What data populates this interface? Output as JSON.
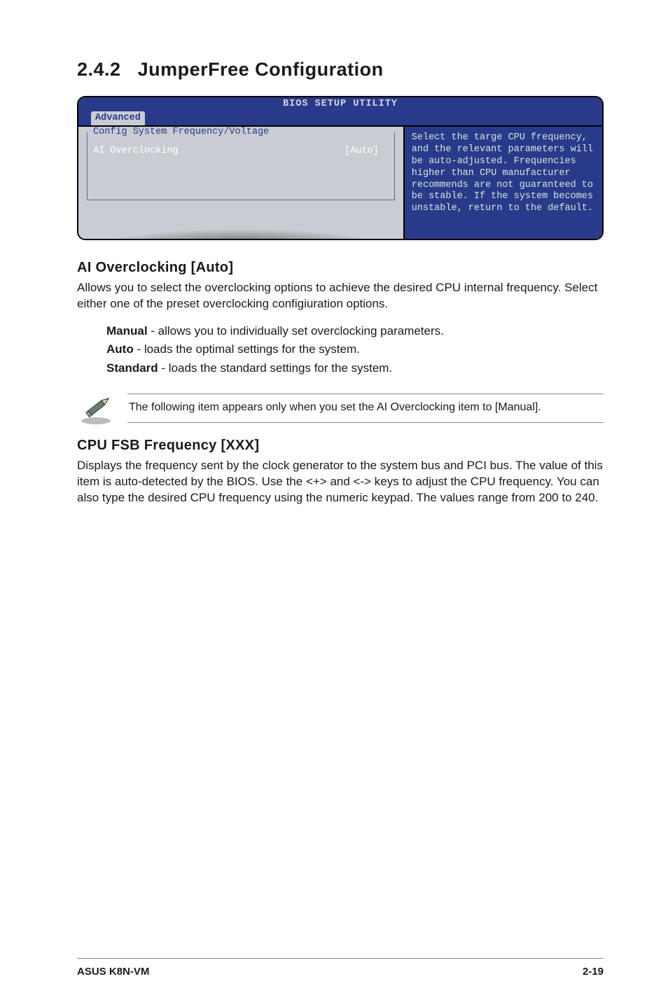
{
  "section": {
    "number": "2.4.2",
    "title": "JumperFree Configuration"
  },
  "bios": {
    "title": "BIOS SETUP UTILITY",
    "tab": "Advanced",
    "group_label": "Config System Frequency/Voltage",
    "row": {
      "key": "AI Overclocking",
      "value": "[Auto]"
    },
    "help": "Select the targe CPU frequency, and the relevant parameters will be auto-adjusted. Frequencies higher than CPU manufacturer recommends are not guaranteed to be stable. If the system becomes unstable, return to the default."
  },
  "ai_overclocking": {
    "heading": "AI Overclocking [Auto]",
    "body": "Allows you to select the overclocking options to achieve the desired CPU internal frequency. Select either one of the preset overclocking configiuration options.",
    "options": [
      {
        "name": "Manual",
        "desc": " - allows you to individually set overclocking parameters."
      },
      {
        "name": "Auto",
        "desc": " - loads the optimal settings for the system."
      },
      {
        "name": "Standard",
        "desc": " - loads the standard settings for the system."
      }
    ]
  },
  "note": "The following item appears only when you set the AI Overclocking item to [Manual].",
  "cpu_fsb": {
    "heading": "CPU FSB Frequency [XXX]",
    "body": "Displays the frequency sent by the clock generator to the system bus and PCI bus. The value of this item is auto-detected by the BIOS. Use the <+> and <-> keys to adjust the CPU frequency. You can also type the desired CPU frequency using the numeric keypad. The values range from 200 to 240."
  },
  "footer": {
    "left": "ASUS K8N-VM",
    "right": "2-19"
  }
}
